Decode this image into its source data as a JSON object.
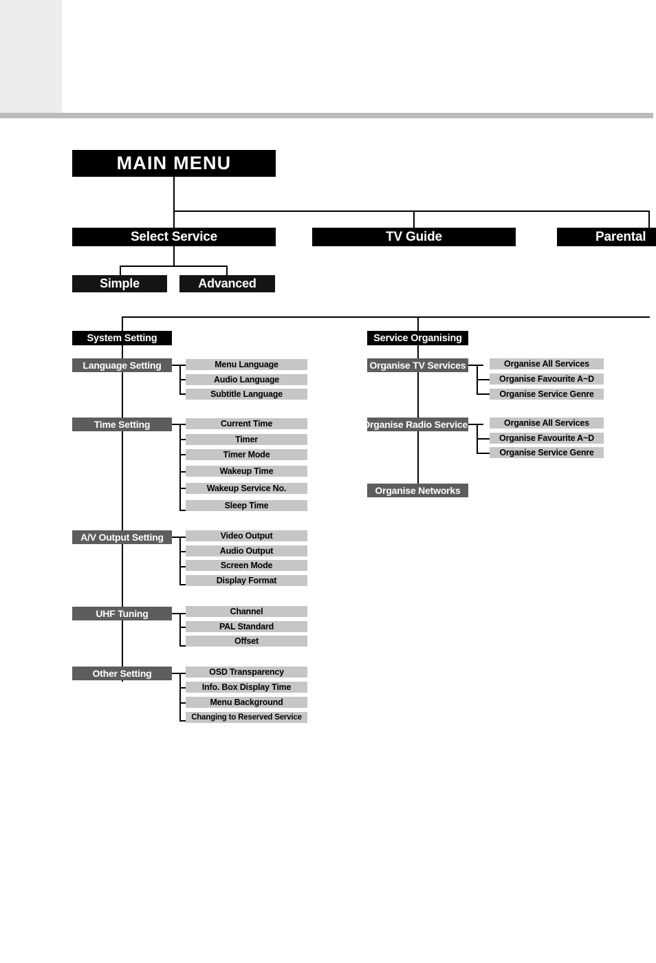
{
  "diagram": {
    "title": "MAIN MENU",
    "root": {
      "label": "MAIN MENU"
    },
    "level1": [
      {
        "label": "Select Service"
      },
      {
        "label": "TV Guide"
      },
      {
        "label": "Parental"
      }
    ],
    "select_service_children": [
      {
        "label": "Simple"
      },
      {
        "label": "Advanced"
      }
    ],
    "branches": [
      {
        "label": "System Setting",
        "groups": [
          {
            "label": "Language Setting",
            "items": [
              {
                "label": "Menu Language"
              },
              {
                "label": "Audio Language"
              },
              {
                "label": "Subtitle Language"
              }
            ]
          },
          {
            "label": "Time Setting",
            "items": [
              {
                "label": "Current Time"
              },
              {
                "label": "Timer"
              },
              {
                "label": "Timer Mode"
              },
              {
                "label": "Wakeup Time"
              },
              {
                "label": "Wakeup Service No."
              },
              {
                "label": "Sleep Time"
              }
            ]
          },
          {
            "label": "A/V Output Setting",
            "items": [
              {
                "label": "Video  Output"
              },
              {
                "label": "Audio Output"
              },
              {
                "label": "Screen Mode"
              },
              {
                "label": "Display Format"
              }
            ]
          },
          {
            "label": "UHF Tuning",
            "items": [
              {
                "label": "Channel"
              },
              {
                "label": "PAL Standard"
              },
              {
                "label": "Offset"
              }
            ]
          },
          {
            "label": "Other Setting",
            "items": [
              {
                "label": "OSD Transparency"
              },
              {
                "label": "Info. Box Display Time"
              },
              {
                "label": "Menu Background"
              },
              {
                "label": "Changing to Reserved Service"
              }
            ]
          }
        ]
      },
      {
        "label": "Service Organising",
        "groups": [
          {
            "label": "Organise TV Services",
            "items": [
              {
                "label": "Organise All Services"
              },
              {
                "label": "Organise Favourite A~D"
              },
              {
                "label": "Organise  Service Genre"
              }
            ]
          },
          {
            "label": "Organise Radio Services",
            "items": [
              {
                "label": "Organise All Services"
              },
              {
                "label": "Organise Favourite A~D"
              },
              {
                "label": "Organise  Service Genre"
              }
            ]
          },
          {
            "label": "Organise Networks",
            "items": []
          }
        ]
      }
    ]
  },
  "colors": {
    "level_top": "#000000",
    "level_group": "#5d5d5d",
    "level_leaf": "#c6c6c6",
    "rule": "#bbbbbb",
    "corner": "#ececec"
  }
}
